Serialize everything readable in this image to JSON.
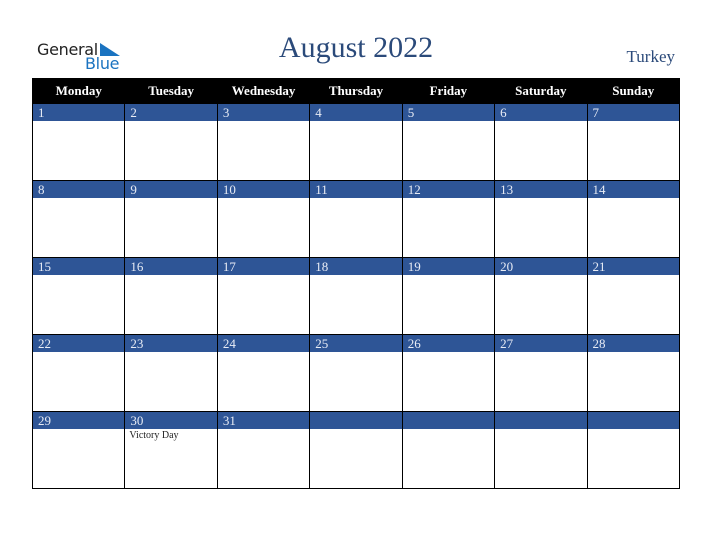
{
  "logo": {
    "word1": "General",
    "word2": "Blue",
    "accent_color": "#1a73c0"
  },
  "header": {
    "title": "August 2022",
    "country": "Turkey"
  },
  "colors": {
    "header_bg": "#000000",
    "day_bar": "#2e5596",
    "title": "#2b4a7a"
  },
  "calendar": {
    "weekdays": [
      "Monday",
      "Tuesday",
      "Wednesday",
      "Thursday",
      "Friday",
      "Saturday",
      "Sunday"
    ],
    "weeks": [
      [
        {
          "day": "1",
          "event": ""
        },
        {
          "day": "2",
          "event": ""
        },
        {
          "day": "3",
          "event": ""
        },
        {
          "day": "4",
          "event": ""
        },
        {
          "day": "5",
          "event": ""
        },
        {
          "day": "6",
          "event": ""
        },
        {
          "day": "7",
          "event": ""
        }
      ],
      [
        {
          "day": "8",
          "event": ""
        },
        {
          "day": "9",
          "event": ""
        },
        {
          "day": "10",
          "event": ""
        },
        {
          "day": "11",
          "event": ""
        },
        {
          "day": "12",
          "event": ""
        },
        {
          "day": "13",
          "event": ""
        },
        {
          "day": "14",
          "event": ""
        }
      ],
      [
        {
          "day": "15",
          "event": ""
        },
        {
          "day": "16",
          "event": ""
        },
        {
          "day": "17",
          "event": ""
        },
        {
          "day": "18",
          "event": ""
        },
        {
          "day": "19",
          "event": ""
        },
        {
          "day": "20",
          "event": ""
        },
        {
          "day": "21",
          "event": ""
        }
      ],
      [
        {
          "day": "22",
          "event": ""
        },
        {
          "day": "23",
          "event": ""
        },
        {
          "day": "24",
          "event": ""
        },
        {
          "day": "25",
          "event": ""
        },
        {
          "day": "26",
          "event": ""
        },
        {
          "day": "27",
          "event": ""
        },
        {
          "day": "28",
          "event": ""
        }
      ],
      [
        {
          "day": "29",
          "event": ""
        },
        {
          "day": "30",
          "event": "Victory Day"
        },
        {
          "day": "31",
          "event": ""
        },
        {
          "day": "",
          "event": ""
        },
        {
          "day": "",
          "event": ""
        },
        {
          "day": "",
          "event": ""
        },
        {
          "day": "",
          "event": ""
        }
      ]
    ]
  }
}
